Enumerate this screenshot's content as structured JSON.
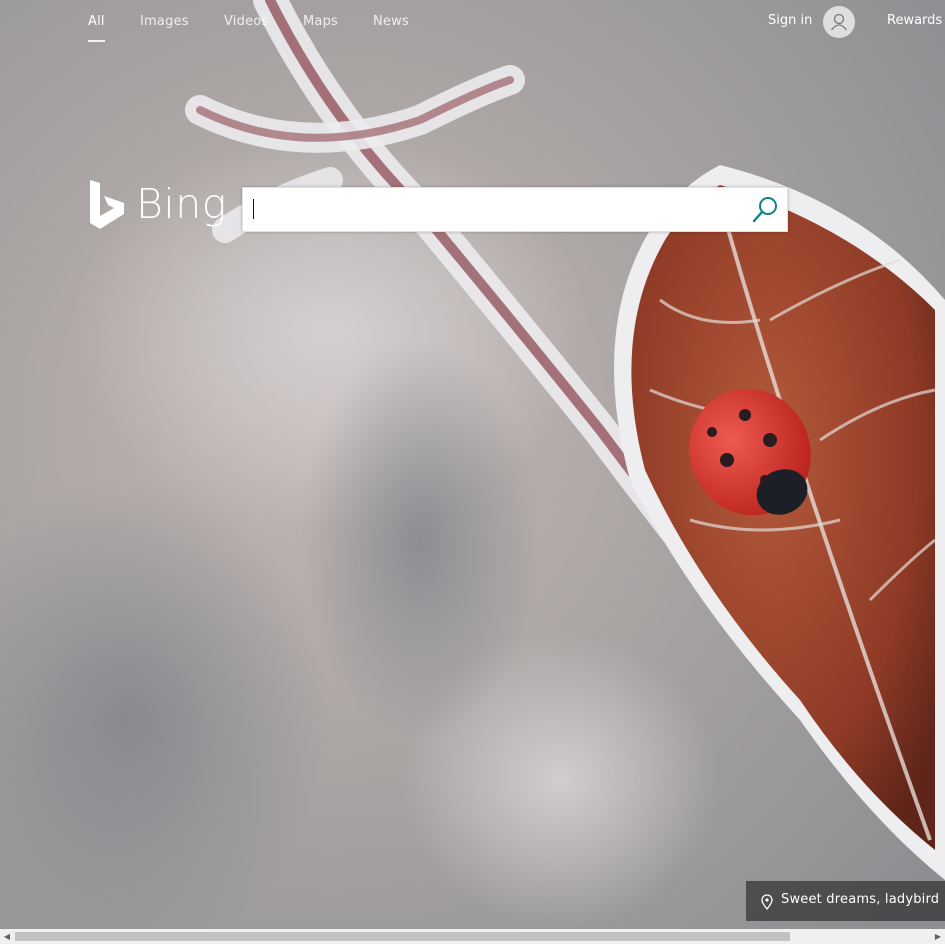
{
  "nav": {
    "items": [
      {
        "label": "All",
        "active": true
      },
      {
        "label": "Images",
        "active": false
      },
      {
        "label": "Videos",
        "active": false
      },
      {
        "label": "Maps",
        "active": false
      },
      {
        "label": "News",
        "active": false
      }
    ],
    "signin_label": "Sign in",
    "avatar_icon": "user-icon",
    "rewards_label": "Rewards"
  },
  "logo": {
    "text": "Bing",
    "icon": "bing-b-icon"
  },
  "search": {
    "value": "",
    "placeholder": "",
    "button_icon": "search-icon",
    "accent": "#0c8484"
  },
  "caption": {
    "icon": "location-pin-icon",
    "text": "Sweet dreams, ladybird"
  },
  "scrollbar": {
    "left_arrow": "◀",
    "right_arrow": "▶"
  }
}
